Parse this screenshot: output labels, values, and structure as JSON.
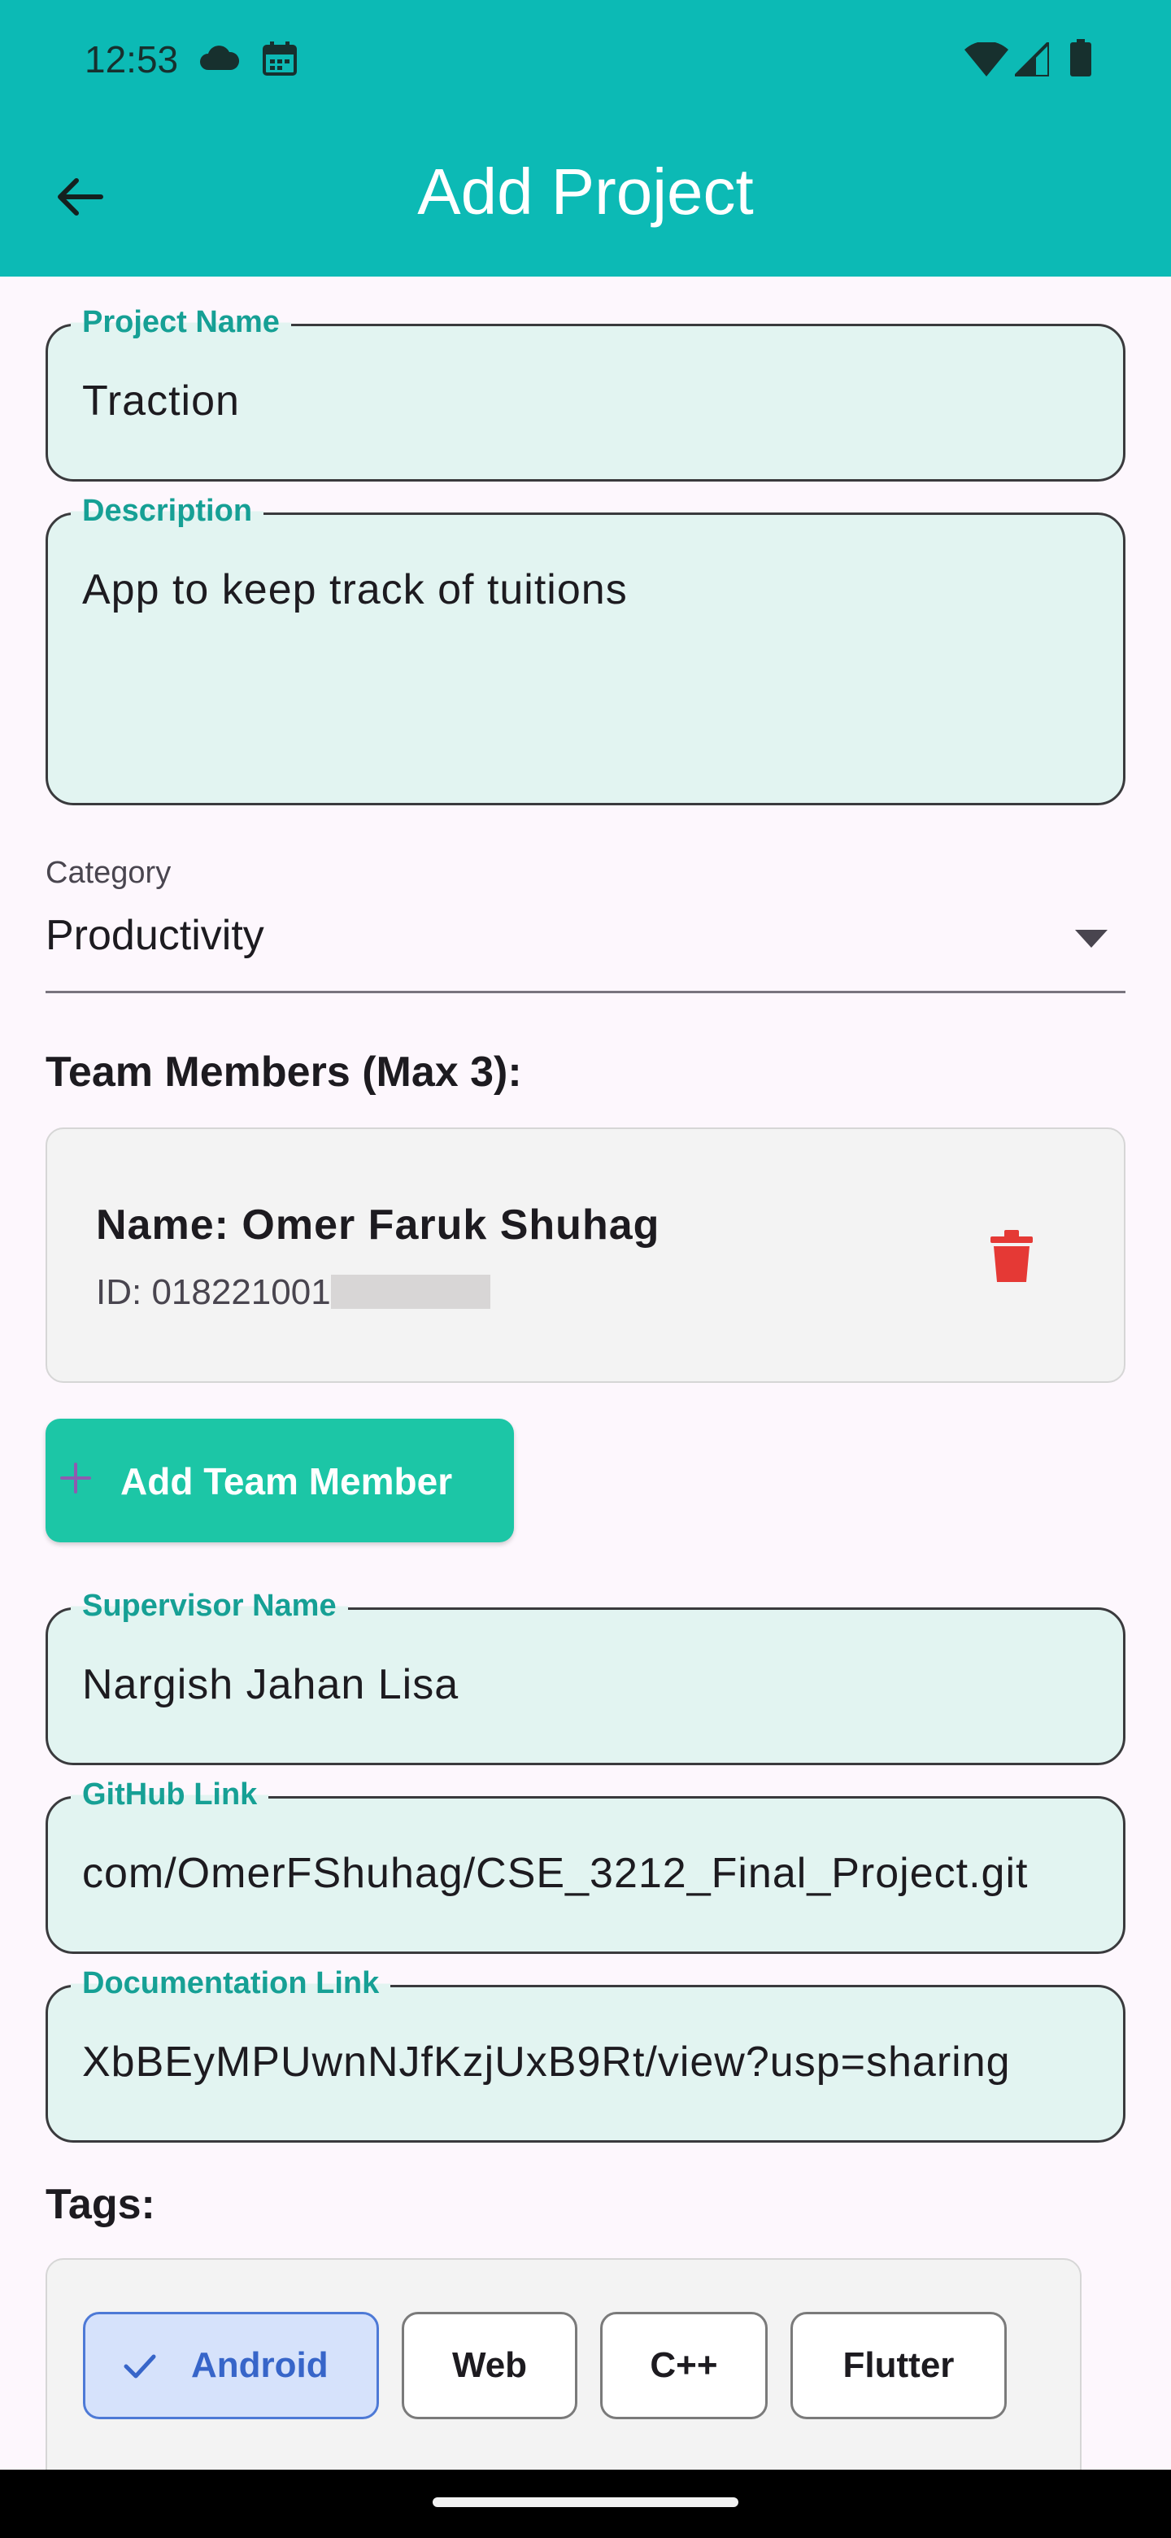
{
  "status_bar": {
    "time": "12:53",
    "icons": [
      "cloud-icon",
      "calendar-icon",
      "wifi-icon",
      "signal-icon",
      "battery-icon"
    ]
  },
  "app_bar": {
    "title": "Add Project",
    "back_icon": "arrow-back-icon",
    "color": "#0cbab5"
  },
  "form": {
    "project_name": {
      "label": "Project Name",
      "value": "Traction"
    },
    "description": {
      "label": "Description",
      "value": "App to keep track of tuitions"
    },
    "category": {
      "label": "Category",
      "value": "Productivity"
    },
    "team_members_title": "Team Members (Max 3):",
    "team_members": [
      {
        "name": "Name: Omer Faruk Shuhag",
        "id": "ID: 018221001"
      }
    ],
    "add_member_label": "Add Team Member",
    "supervisor": {
      "label": "Supervisor Name",
      "value": "Nargish Jahan Lisa"
    },
    "github": {
      "label": "GitHub Link",
      "value": "com/OmerFShuhag/CSE_3212_Final_Project.git"
    },
    "documentation": {
      "label": "Documentation Link",
      "value": "XbBEyMPUwnNJfKzjUxB9Rt/view?usp=sharing"
    },
    "tags_title": "Tags:",
    "tags": [
      {
        "label": "Android",
        "selected": true
      },
      {
        "label": "Web",
        "selected": false
      },
      {
        "label": "C++",
        "selected": false
      },
      {
        "label": "Flutter",
        "selected": false
      }
    ]
  },
  "colors": {
    "accent": "#16a095",
    "field_bg": "#e2f4f1",
    "add_button": "#1cc6a6",
    "delete": "#e53935",
    "chip_selected_bg": "#d6e2fb"
  }
}
